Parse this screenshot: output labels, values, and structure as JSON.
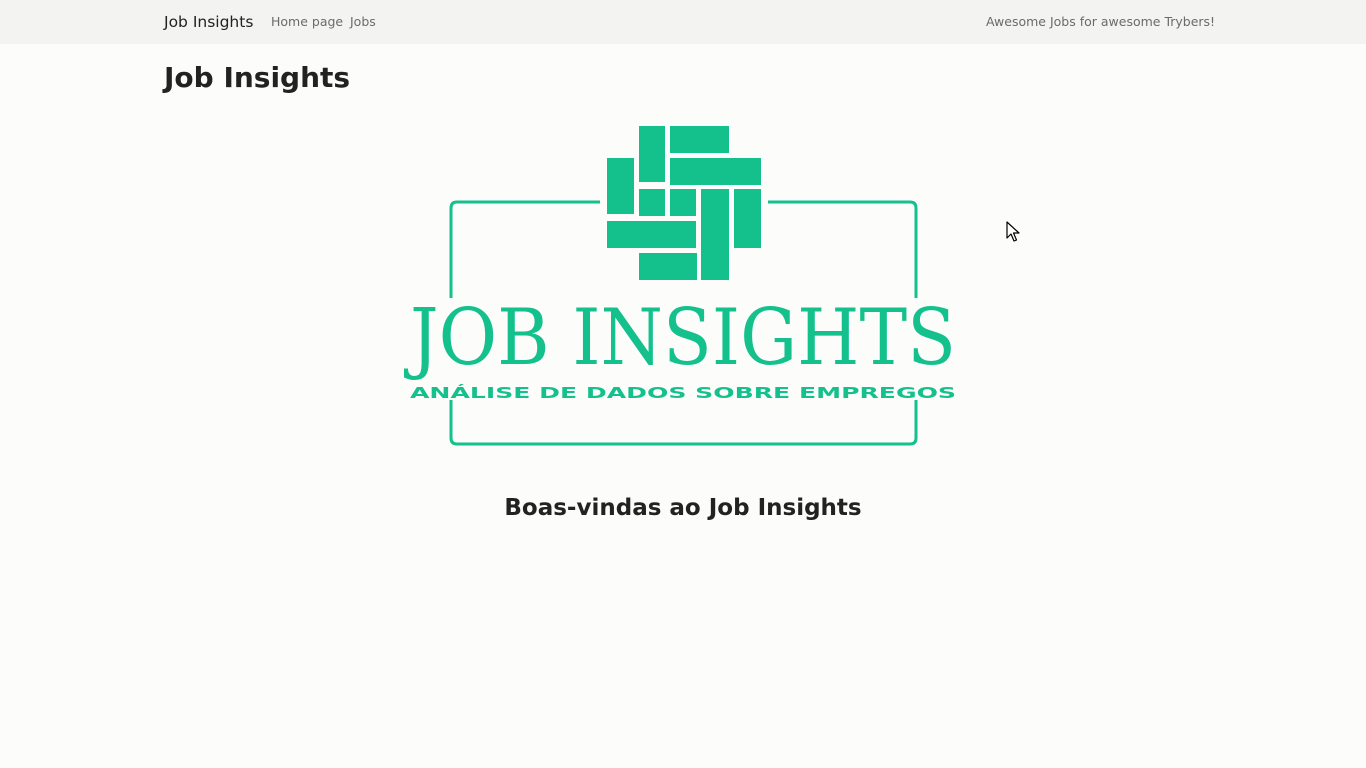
{
  "navbar": {
    "brand": "Job Insights",
    "links": [
      "Home page",
      "Jobs"
    ],
    "tagline": "Awesome Jobs for awesome Trybers!"
  },
  "page": {
    "title": "Job Insights",
    "welcome": "Boas-vindas ao Job Insights"
  },
  "logo": {
    "title": "JOB INSIGHTS",
    "subtitle": "ANÁLISE DE DADOS SOBRE EMPREGOS",
    "color": "#14c18c"
  },
  "icons": {
    "cursor": "mouse-pointer-icon"
  }
}
